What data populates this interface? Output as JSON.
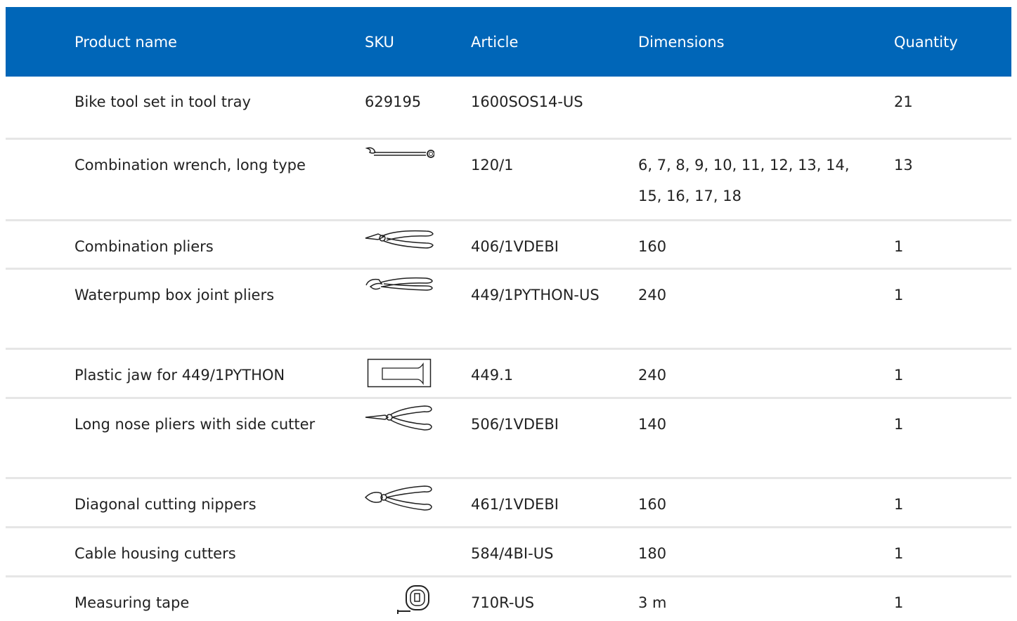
{
  "header": {
    "product_name": "Product name",
    "sku": "SKU",
    "article": "Article",
    "dimensions": "Dimensions",
    "quantity": "Quantity"
  },
  "rows": [
    {
      "name": "Bike tool set in tool tray",
      "sku": "629195",
      "article": "1600SOS14-US",
      "dimensions": "",
      "quantity": "21",
      "icon": "none"
    },
    {
      "name": "Combination wrench, long type",
      "sku": "",
      "article": "120/1",
      "dimensions": "6, 7, 8, 9, 10, 11, 12, 13, 14, 15, 16, 17, 18",
      "quantity": "13",
      "icon": "combination-wrench-icon"
    },
    {
      "name": "Combination pliers",
      "sku": "",
      "article": "406/1VDEBI",
      "dimensions": "160",
      "quantity": "1",
      "icon": "combination-pliers-icon"
    },
    {
      "name": "Waterpump box joint pliers",
      "sku": "",
      "article": "449/1PYTHON-US",
      "dimensions": "240",
      "quantity": "1",
      "icon": "waterpump-pliers-icon"
    },
    {
      "name": "Plastic jaw for 449/1PYTHON",
      "sku": "",
      "article": "449.1",
      "dimensions": "240",
      "quantity": "1",
      "icon": "plastic-jaw-icon"
    },
    {
      "name": "Long nose pliers with side cutter",
      "sku": "",
      "article": "506/1VDEBI",
      "dimensions": "140",
      "quantity": "1",
      "icon": "long-nose-pliers-icon"
    },
    {
      "name": "Diagonal cutting nippers",
      "sku": "",
      "article": "461/1VDEBI",
      "dimensions": "160",
      "quantity": "1",
      "icon": "diagonal-nippers-icon"
    },
    {
      "name": "Cable housing cutters",
      "sku": "",
      "article": "584/4BI-US",
      "dimensions": "180",
      "quantity": "1",
      "icon": "none"
    },
    {
      "name": "Measuring tape",
      "sku": "",
      "article": "710R-US",
      "dimensions": "3 m",
      "quantity": "1",
      "icon": "measuring-tape-icon"
    }
  ],
  "colors": {
    "header_bg": "#0066b8",
    "divider": "#e6e6e6"
  }
}
